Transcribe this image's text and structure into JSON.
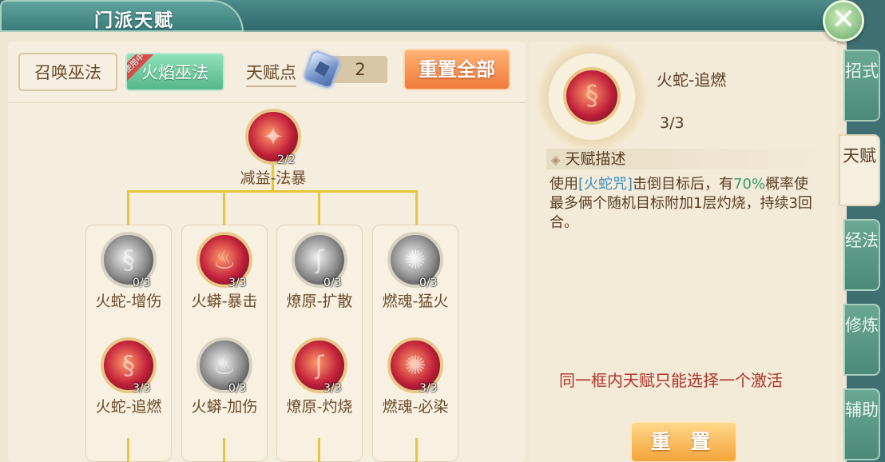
{
  "window": {
    "title": "门派天赋",
    "close_icon": "close-icon"
  },
  "school_tabs": [
    {
      "label": "召唤巫法",
      "active": false
    },
    {
      "label": "火焰巫法",
      "active": true,
      "badge": "使用中"
    }
  ],
  "talent_points": {
    "label": "天赋点",
    "value": "2"
  },
  "reset_all_label": "重置全部",
  "root_node": {
    "name": "减益-法暴",
    "count": "2/2",
    "active": true
  },
  "columns": [
    {
      "nodes": [
        {
          "name": "火蛇-增伤",
          "count": "0/3",
          "active": false
        },
        {
          "name": "火蛇-追燃",
          "count": "3/3",
          "active": true
        }
      ]
    },
    {
      "nodes": [
        {
          "name": "火蟒-暴击",
          "count": "3/3",
          "active": true
        },
        {
          "name": "火蟒-加伤",
          "count": "0/3",
          "active": false
        }
      ]
    },
    {
      "nodes": [
        {
          "name": "燎原-扩散",
          "count": "0/3",
          "active": false
        },
        {
          "name": "燎原-灼烧",
          "count": "3/3",
          "active": true
        }
      ]
    },
    {
      "nodes": [
        {
          "name": "燃魂-猛火",
          "count": "0/3",
          "active": false
        },
        {
          "name": "燃魂-必染",
          "count": "3/3",
          "active": true
        }
      ]
    }
  ],
  "selected": {
    "name": "火蛇-追燃",
    "level": "3/3",
    "desc_title": "天赋描述",
    "desc_part1": "使用",
    "desc_skill": "[火蛇咒]",
    "desc_part2": "击倒目标后，有",
    "desc_rate": "70%",
    "desc_part3": "概率使最多俩个随机目标附加1层灼烧，持续3回合。"
  },
  "note": "同一框内天赋只能选择一个激活",
  "reset_label": "重 置",
  "side_tabs": [
    {
      "label": "招式",
      "active": false
    },
    {
      "label": "天赋",
      "active": true
    },
    {
      "label": "经法",
      "active": false
    },
    {
      "label": "修炼",
      "active": false
    },
    {
      "label": "辅助",
      "active": false
    }
  ],
  "colors": {
    "accent_orange": "#f07a3c",
    "tree_line": "#e7c63a",
    "note_red": "#b0342a"
  }
}
